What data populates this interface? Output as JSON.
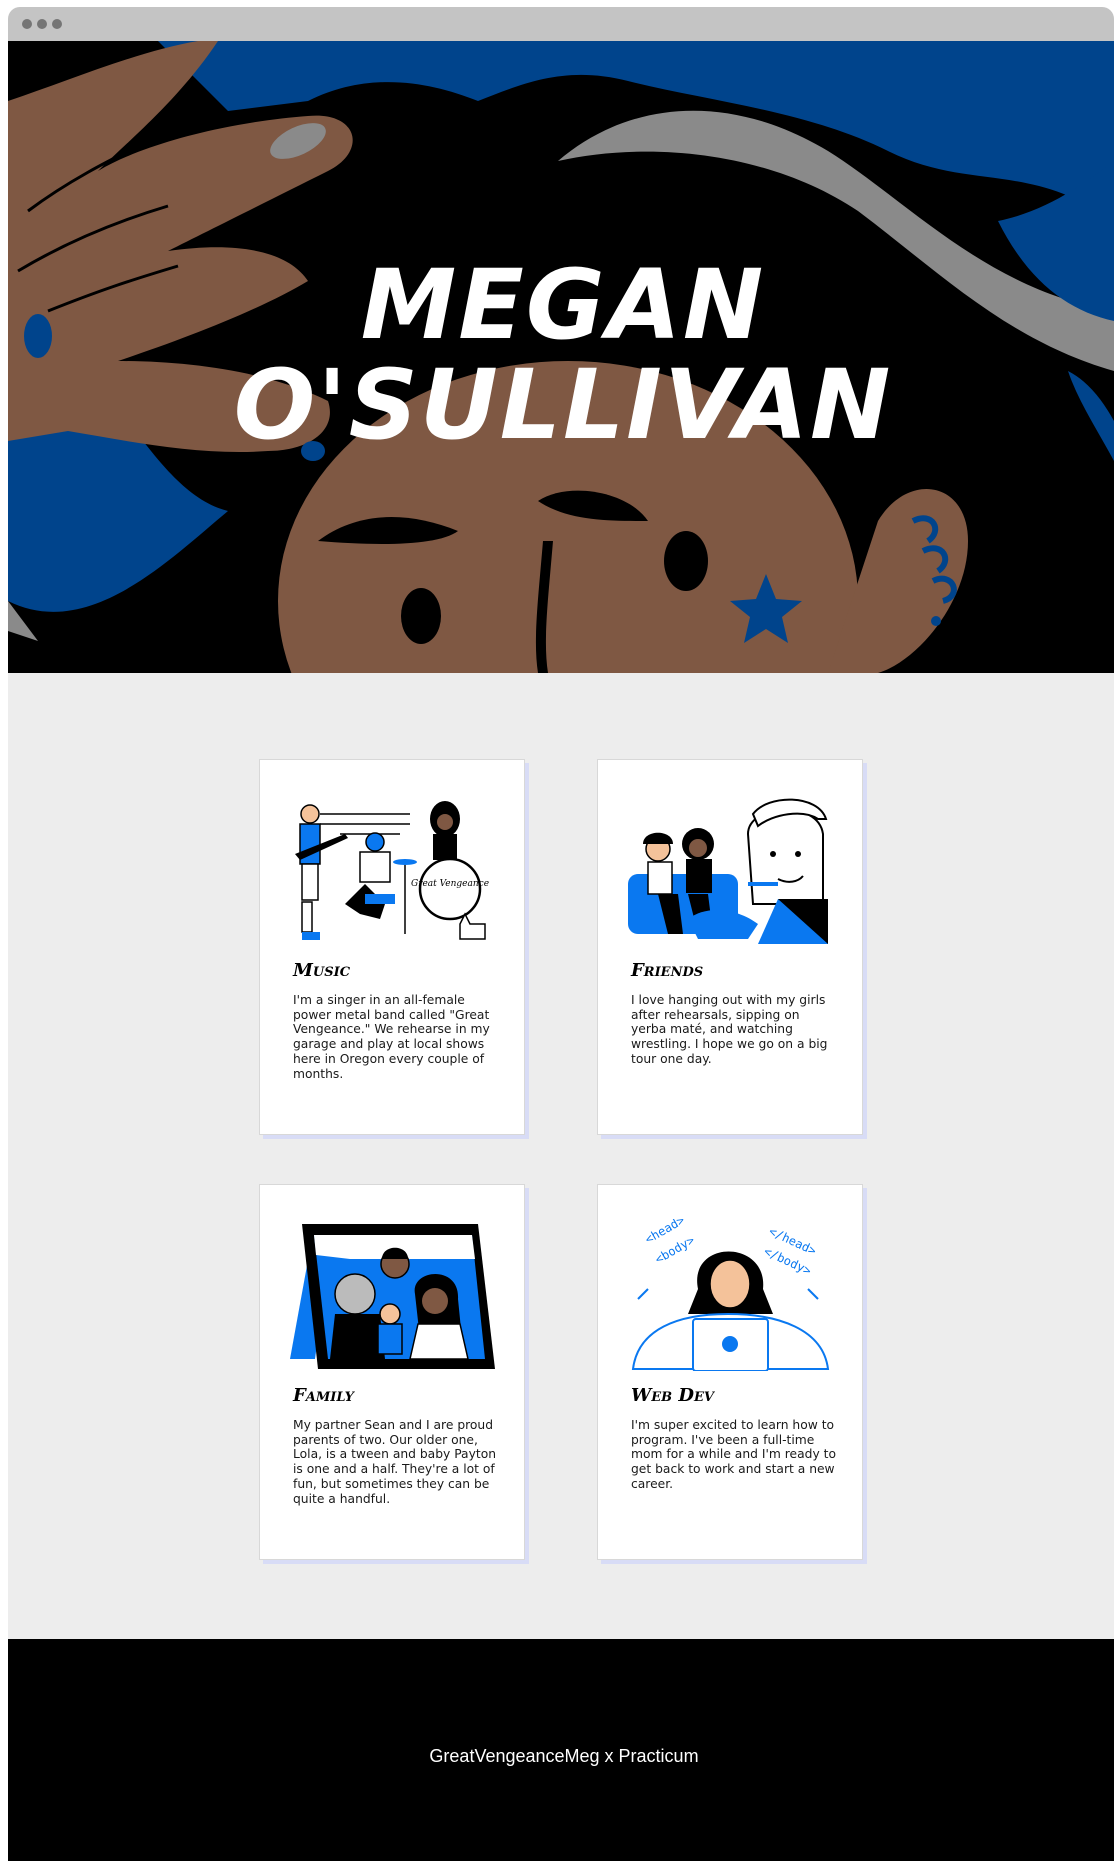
{
  "hero": {
    "title_line1": "Megan",
    "title_line2": "O'Sullivan"
  },
  "cards": [
    {
      "title": "Music",
      "text": "I'm a singer in an all-female power metal band called \"Great Vengeance.\" We rehearse in my garage and play at local shows here in Oregon every couple of months.",
      "illustration_label": "Great Vengeance"
    },
    {
      "title": "Friends",
      "text": "I love hanging out with my girls after rehearsals, sipping on yerba maté, and watching wrestling. I hope we go on a big tour one day."
    },
    {
      "title": "Family",
      "text": "My partner Sean and I are proud parents of two. Our older one, Lola, is a tween and baby Payton is one and a half. They're a lot of fun, but sometimes they can be quite a handful."
    },
    {
      "title": "Web Dev",
      "text": "I'm super excited to learn how to program. I've been a full-time mom for a while and I'm ready to get back to work and start a new career.",
      "illustration_tags": [
        "<head>",
        "<body>",
        "</head>",
        "</body>"
      ]
    }
  ],
  "footer": {
    "text": "GreatVengeanceMeg x Practicum"
  },
  "colors": {
    "hero_blue": "#00448c",
    "accent_blue": "#0a78f0",
    "skin": "#7f5843",
    "page_bg": "#ededed",
    "footer_bg": "#000000"
  }
}
